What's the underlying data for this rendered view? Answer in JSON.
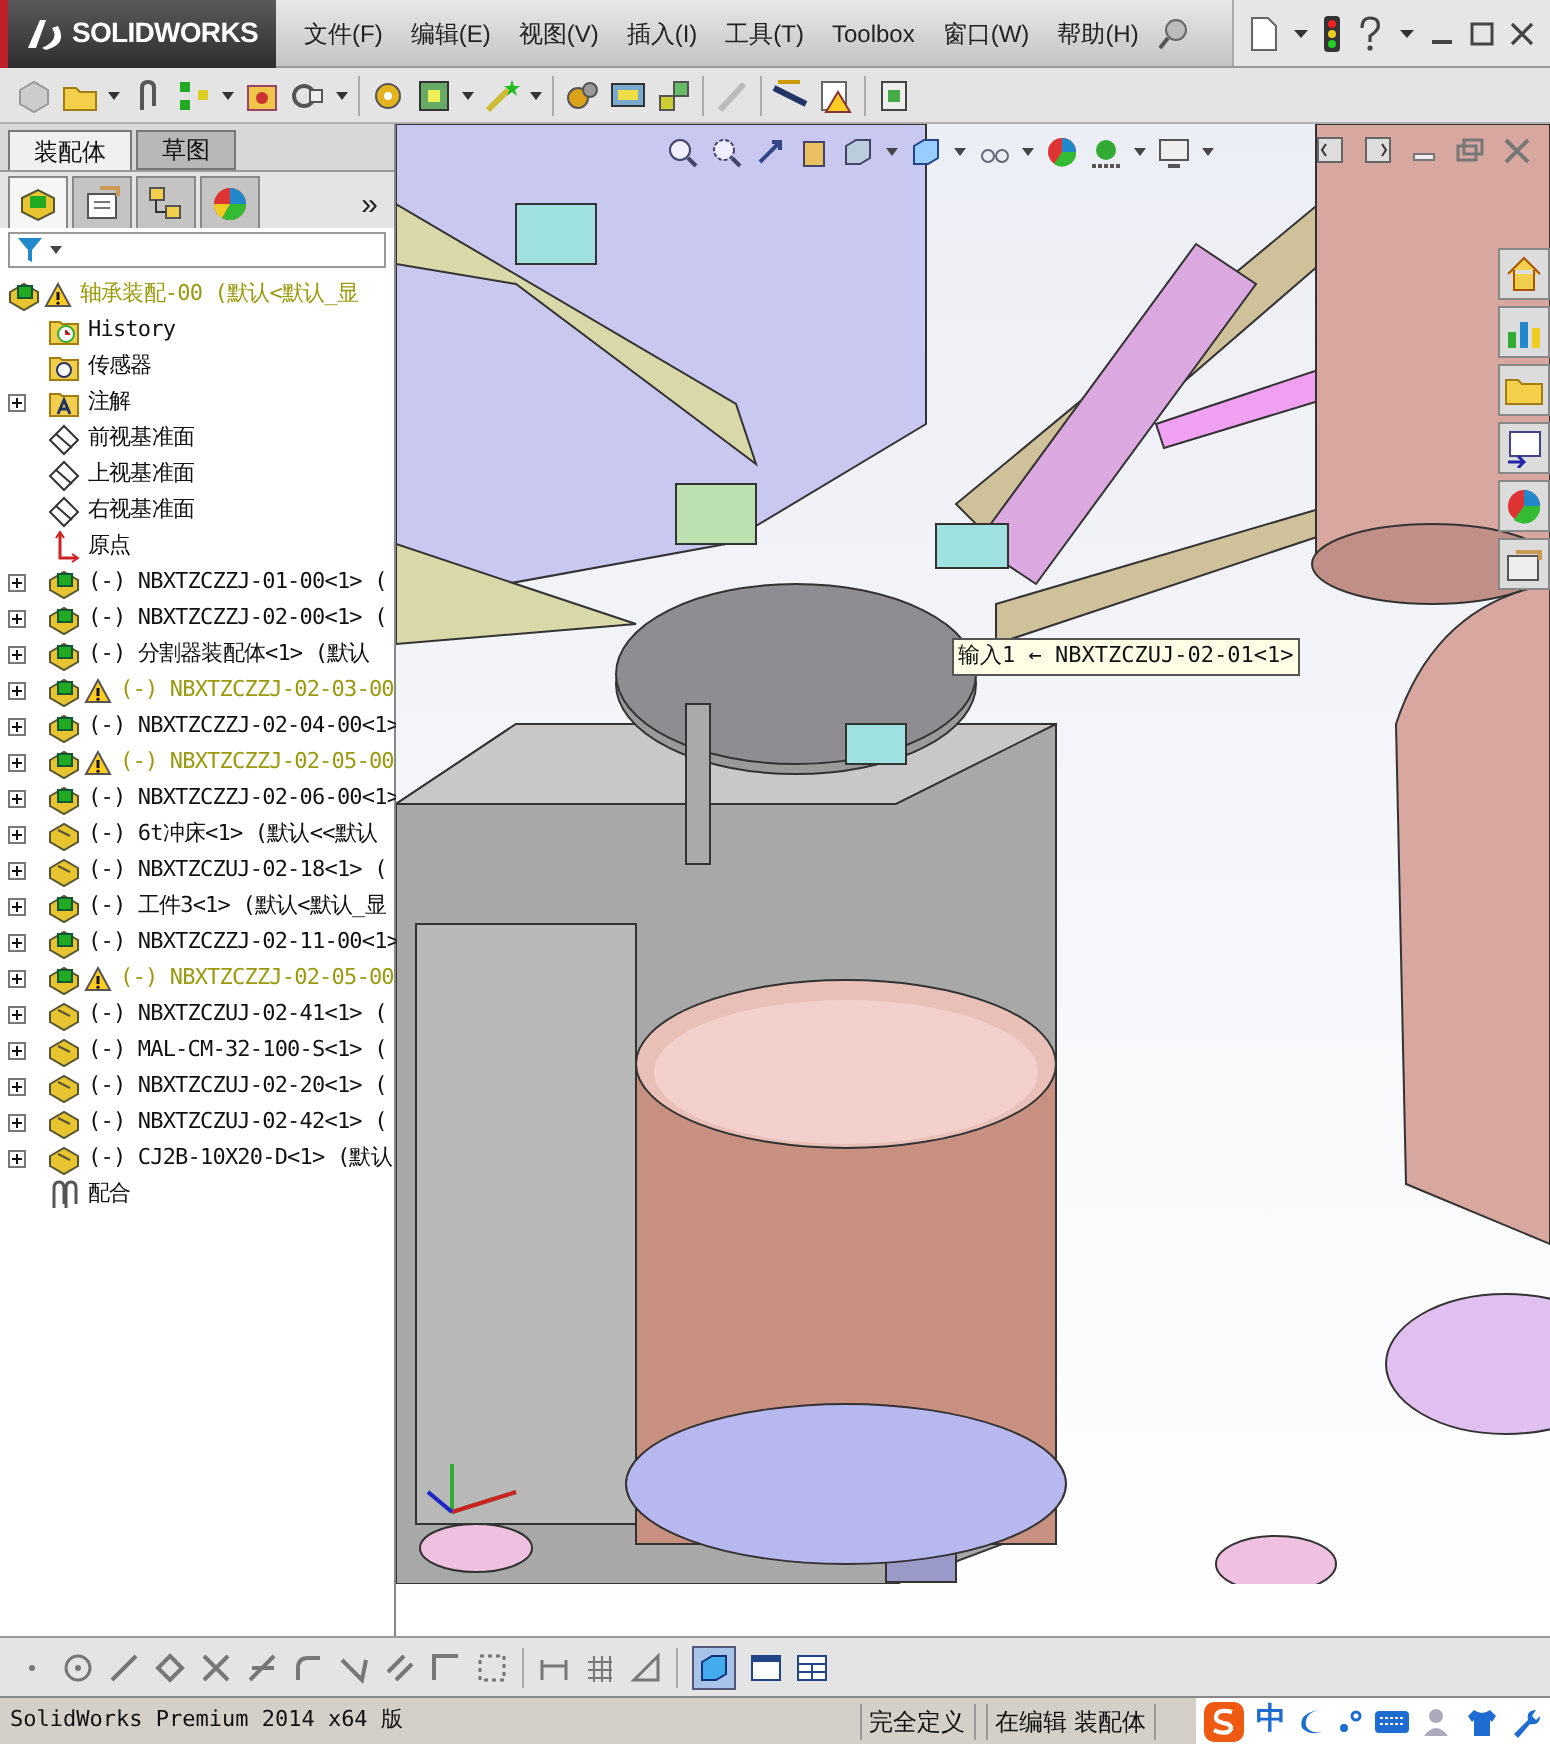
{
  "title_bar": {
    "logo": "SOLIDWORKS",
    "menu": [
      "文件(F)",
      "编辑(E)",
      "视图(V)",
      "插入(I)",
      "工具(T)",
      "Toolbox",
      "窗口(W)",
      "帮助(H)"
    ]
  },
  "panel": {
    "tabs": [
      {
        "label": "装配体",
        "selected": true
      },
      {
        "label": "草图",
        "selected": false
      }
    ],
    "manager_tabs": [
      {
        "kind": "tree",
        "selected": true
      },
      {
        "kind": "property",
        "selected": false
      },
      {
        "kind": "config",
        "selected": false
      },
      {
        "kind": "display",
        "selected": false
      }
    ],
    "more": "»",
    "tree": {
      "label": "轴承装配-00  (默认<默认_显",
      "kind": "assembly",
      "warning": true,
      "children": [
        {
          "label": "History",
          "kind": "history"
        },
        {
          "label": "传感器",
          "kind": "sensor"
        },
        {
          "label": "注解",
          "kind": "annotation",
          "expanded": false
        },
        {
          "label": "前视基准面",
          "kind": "plane"
        },
        {
          "label": "上视基准面",
          "kind": "plane"
        },
        {
          "label": "右视基准面",
          "kind": "plane"
        },
        {
          "label": "原点",
          "kind": "origin"
        },
        {
          "label": "(-) NBXTZCZZJ-01-00<1> (",
          "kind": "assembly",
          "warning": false,
          "expanded": false
        },
        {
          "label": "(-) NBXTZCZZJ-02-00<1> (",
          "kind": "assembly",
          "warning": false,
          "expanded": false
        },
        {
          "label": "(-) 分割器装配体<1> (默认",
          "kind": "assembly",
          "warning": false,
          "expanded": false
        },
        {
          "label": "(-) NBXTZCZZJ-02-03-00",
          "kind": "assembly",
          "warning": true,
          "expanded": false
        },
        {
          "label": "(-) NBXTZCZZJ-02-04-00<1>",
          "kind": "assembly",
          "warning": false,
          "expanded": false
        },
        {
          "label": "(-) NBXTZCZZJ-02-05-00",
          "kind": "assembly",
          "warning": true,
          "expanded": false
        },
        {
          "label": "(-) NBXTZCZZJ-02-06-00<1>",
          "kind": "assembly",
          "warning": false,
          "expanded": false
        },
        {
          "label": "(-) 6t冲床<1> (默认<<默认",
          "kind": "part",
          "warning": false,
          "expanded": false
        },
        {
          "label": "(-) NBXTZCZUJ-02-18<1> (",
          "kind": "part",
          "warning": false,
          "expanded": false
        },
        {
          "label": "(-) 工件3<1> (默认<默认_显",
          "kind": "assembly",
          "warning": false,
          "expanded": false
        },
        {
          "label": "(-) NBXTZCZZJ-02-11-00<1>",
          "kind": "assembly",
          "warning": false,
          "expanded": false
        },
        {
          "label": "(-) NBXTZCZZJ-02-05-00",
          "kind": "assembly",
          "warning": true,
          "expanded": false
        },
        {
          "label": "(-) NBXTZCZUJ-02-41<1> (",
          "kind": "part",
          "warning": false,
          "expanded": false
        },
        {
          "label": "(-) MAL-CM-32-100-S<1> (",
          "kind": "part",
          "warning": false,
          "expanded": false
        },
        {
          "label": "(-) NBXTZCZUJ-02-20<1> (",
          "kind": "part",
          "warning": false,
          "expanded": false
        },
        {
          "label": "(-) NBXTZCZUJ-02-42<1> (",
          "kind": "part",
          "warning": false,
          "expanded": false
        },
        {
          "label": "(-) CJ2B-10X20-D<1> (默认",
          "kind": "part",
          "warning": false,
          "expanded": false
        },
        {
          "label": "配合",
          "kind": "mates"
        }
      ]
    }
  },
  "viewport": {
    "tooltip": "输入1 ← NBXTZCZUJ-02-01<1>"
  },
  "status_bar": {
    "product": "SolidWorks Premium 2014 x64 版",
    "state": "完全定义",
    "mode": "在编辑 装配体",
    "ime": "中"
  }
}
